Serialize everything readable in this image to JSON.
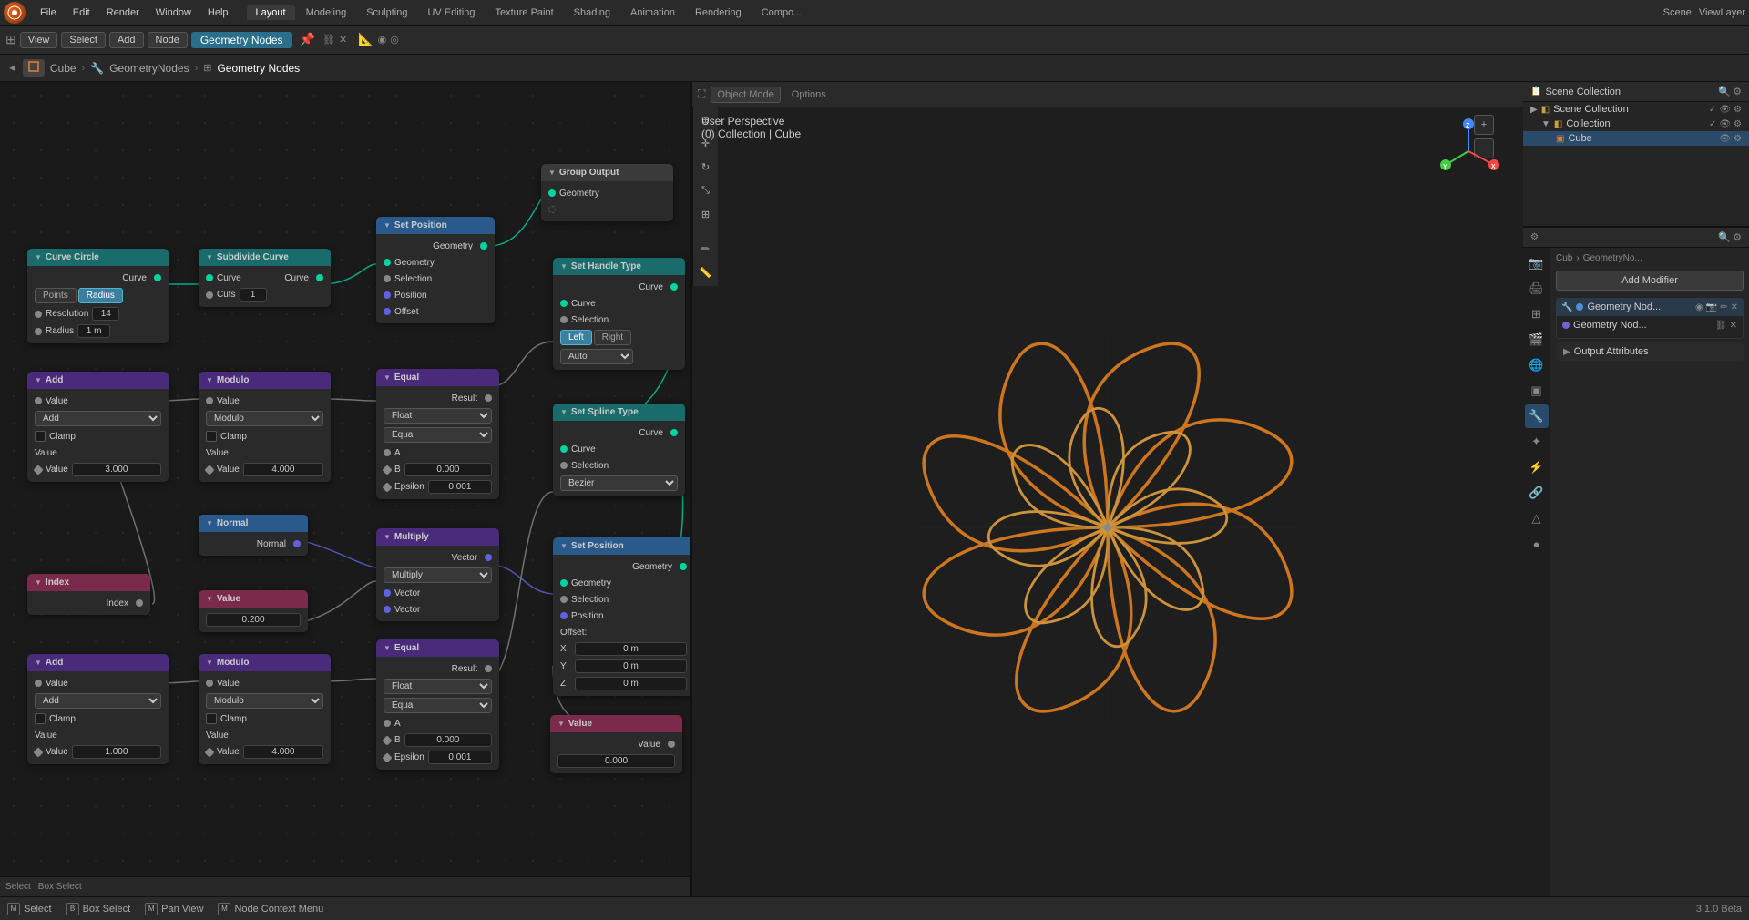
{
  "app": {
    "logo": "blender-logo",
    "version": "3.1.0 Beta"
  },
  "top_menu": {
    "items": [
      "File",
      "Edit",
      "Render",
      "Window",
      "Help"
    ],
    "workspaces": [
      "Layout",
      "Modeling",
      "Sculpting",
      "UV Editing",
      "Texture Paint",
      "Shading",
      "Animation",
      "Rendering",
      "Compo..."
    ]
  },
  "second_toolbar": {
    "view_label": "View",
    "select_label": "Select",
    "add_label": "Add",
    "node_label": "Node",
    "node_tree": "Geometry Nodes"
  },
  "breadcrumb": {
    "items": [
      "Cube",
      "GeometryNodes",
      "Geometry Nodes"
    ]
  },
  "nodes": {
    "curve_circle": {
      "title": "Curve Circle",
      "header_color": "teal",
      "outputs": [
        "Curve"
      ],
      "inputs": [],
      "fields": [
        {
          "label": "Points",
          "type": "button"
        },
        {
          "label": "Radius",
          "type": "button",
          "active": true
        },
        {
          "label": "Resolution",
          "value": "14"
        },
        {
          "label": "Radius",
          "value": "1 m"
        }
      ]
    },
    "subdivide_curve": {
      "title": "Subdivide Curve",
      "inputs": [
        "Curve"
      ],
      "outputs": [
        "Curve"
      ],
      "fields": [
        {
          "label": "Cuts",
          "value": "1"
        }
      ]
    },
    "set_position_1": {
      "title": "Set Position",
      "inputs": [
        "Geometry",
        "Selection",
        "Position",
        "Offset"
      ],
      "outputs": [
        "Geometry"
      ]
    },
    "group_output": {
      "title": "Group Output",
      "inputs": [
        "Geometry"
      ],
      "outputs": []
    },
    "set_handle_type": {
      "title": "Set Handle Type",
      "inputs": [
        "Curve",
        "Selection"
      ],
      "outputs": [
        "Curve"
      ],
      "fields": [
        {
          "label": "Left",
          "active": true
        },
        {
          "label": "Right"
        },
        {
          "label": "Auto"
        }
      ]
    },
    "set_spline_type": {
      "title": "Set Spline Type",
      "inputs": [
        "Curve",
        "Selection"
      ],
      "outputs": [
        "Curve"
      ],
      "fields": [
        {
          "label": "Bezier"
        }
      ]
    },
    "set_position_2": {
      "title": "Set Position",
      "inputs": [
        "Geometry",
        "Selection",
        "Position"
      ],
      "outputs": [
        "Geometry"
      ],
      "offset": {
        "x": "0 m",
        "y": "0 m",
        "z": "0 m"
      }
    },
    "add_1": {
      "title": "Add",
      "inputs": [
        "Value"
      ],
      "outputs": [
        "Value"
      ],
      "fields": [
        {
          "label": "Add"
        },
        {
          "label": "Clamp"
        },
        {
          "label": "Value",
          "value": "3.000"
        }
      ]
    },
    "modulo_1": {
      "title": "Modulo",
      "inputs": [
        "Value"
      ],
      "outputs": [
        "Value"
      ],
      "fields": [
        {
          "label": "Modulo"
        },
        {
          "label": "Clamp"
        },
        {
          "label": "Value",
          "value": "4.000"
        }
      ]
    },
    "equal_1": {
      "title": "Equal",
      "inputs": [
        "A",
        "B",
        "Epsilon"
      ],
      "outputs": [
        "Result"
      ],
      "fields": [
        {
          "label": "Float"
        },
        {
          "label": "Equal"
        },
        {
          "label": "B",
          "value": "0.000"
        },
        {
          "label": "Epsilon",
          "value": "0.001"
        }
      ]
    },
    "add_2": {
      "title": "Add",
      "inputs": [
        "Value"
      ],
      "outputs": [
        "Value"
      ],
      "fields": [
        {
          "label": "Add"
        },
        {
          "label": "Clamp"
        },
        {
          "label": "Value",
          "value": "1.000"
        }
      ]
    },
    "modulo_2": {
      "title": "Modulo",
      "inputs": [
        "Value"
      ],
      "outputs": [
        "Value"
      ],
      "fields": [
        {
          "label": "Modulo"
        },
        {
          "label": "Clamp"
        },
        {
          "label": "Value",
          "value": "4.000"
        }
      ]
    },
    "equal_2": {
      "title": "Equal",
      "inputs": [
        "A",
        "B",
        "Epsilon"
      ],
      "outputs": [
        "Result"
      ],
      "fields": [
        {
          "label": "Float"
        },
        {
          "label": "Equal"
        },
        {
          "label": "B",
          "value": "0.000"
        },
        {
          "label": "Epsilon",
          "value": "0.001"
        }
      ]
    },
    "normal": {
      "title": "Normal",
      "outputs": [
        "Normal"
      ]
    },
    "multiply": {
      "title": "Multiply",
      "inputs": [
        "Vector",
        "Vector"
      ],
      "outputs": [
        "Vector"
      ],
      "fields": [
        {
          "label": "Multiply"
        }
      ]
    },
    "index": {
      "title": "Index",
      "outputs": [
        "Index"
      ]
    },
    "value": {
      "title": "Value",
      "outputs": [
        "Value"
      ],
      "fields": [
        {
          "value": "0.200"
        }
      ]
    },
    "value_2": {
      "title": "Value",
      "outputs": [
        "Value"
      ],
      "fields": [
        {
          "value": "0.000"
        }
      ]
    }
  },
  "viewport": {
    "mode": "Object Mode",
    "perspective": "User Perspective",
    "collection": "(0) Collection | Cube",
    "options_label": "Options"
  },
  "outliner": {
    "title": "Scene Collection",
    "items": [
      {
        "name": "Scene Collection",
        "level": 0,
        "type": "collection"
      },
      {
        "name": "Collection",
        "level": 1,
        "type": "collection"
      },
      {
        "name": "Cube",
        "level": 2,
        "type": "object",
        "selected": true
      }
    ]
  },
  "properties": {
    "breadcrumb": [
      "Cub",
      "GeometryNo..."
    ],
    "add_modifier": "Add Modifier",
    "geometry_nodes_modifier": "Geometry Nod...",
    "output_attributes": "Output Attributes"
  },
  "status_bar": {
    "select": "Select",
    "box_select": "Box Select",
    "pan_view": "Pan View",
    "node_context": "Node Context Menu"
  }
}
